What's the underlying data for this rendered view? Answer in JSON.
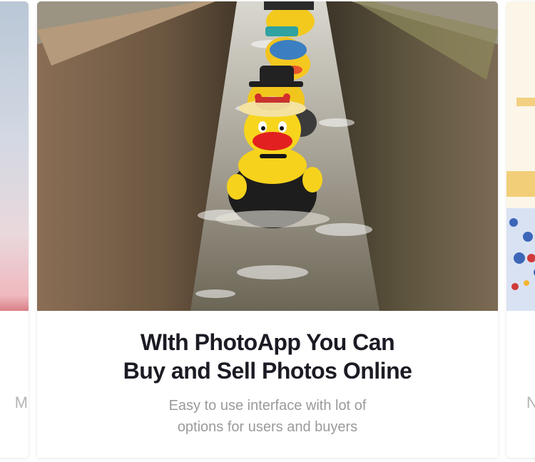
{
  "slides": {
    "previous": {
      "caption_fragment": "M"
    },
    "current": {
      "title_line1": "WIth PhotoApp You Can",
      "title_line2": "Buy and Sell Photos Online",
      "subtitle_line1": "Easy to use interface with lot of",
      "subtitle_line2": "options for users and buyers"
    },
    "next": {
      "caption_fragment": "N"
    }
  }
}
